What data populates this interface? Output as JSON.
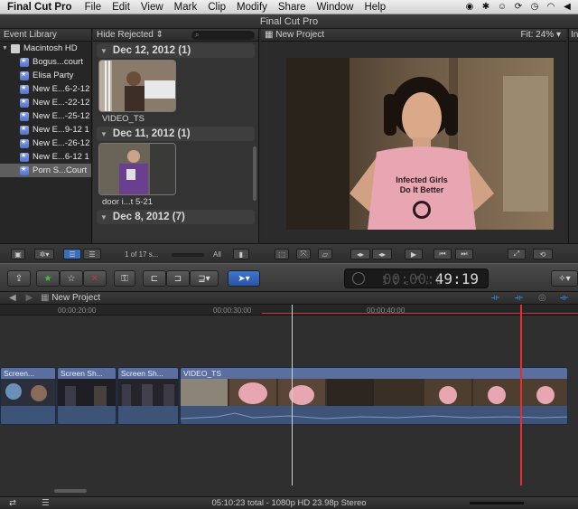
{
  "menubar": {
    "app_name": "Final Cut Pro",
    "items": [
      "File",
      "Edit",
      "View",
      "Mark",
      "Clip",
      "Modify",
      "Share",
      "Window",
      "Help"
    ]
  },
  "window": {
    "title": "Final Cut Pro"
  },
  "library": {
    "header": "Event Library",
    "root": "Macintosh HD",
    "events": [
      "Bogus...court",
      "Elisa Party",
      "New E...6-2-12",
      "New E...-22-12",
      "New E...-25-12",
      "New E...9-12 1",
      "New E...-26-12",
      "New E...6-12 1",
      "Porn S...Court"
    ],
    "selected_index": 8
  },
  "browser": {
    "filter_label": "Hide Rejected",
    "groups": [
      {
        "date": "Dec 12, 2012",
        "count": "(1)",
        "clip": "VIDEO_TS"
      },
      {
        "date": "Dec 11, 2012",
        "count": "(1)",
        "clip": "door i...t 5-21"
      },
      {
        "date": "Dec 8, 2012",
        "count": "(7)",
        "clip": ""
      }
    ],
    "selection_text": "1 of 17 s...",
    "zoom_label": "All"
  },
  "viewer": {
    "title": "New Project",
    "fit_label": "Fit:",
    "zoom": "24%",
    "shirt_text_line1": "Infected Girls",
    "shirt_text_line2": "Do It Better"
  },
  "inspector": {
    "title": "In"
  },
  "toolbar": {
    "timecode_value": "49:19",
    "timecode_dim": "00:00:",
    "timecode_units": "HR MIN SEC FR"
  },
  "timeline": {
    "title": "New Project",
    "ruler_ticks": [
      "00:00:20:00",
      "00:00:30:00",
      "00:00:40:00"
    ],
    "clips": [
      "Screen...",
      "Screen Sh...",
      "Screen Sh...",
      "VIDEO_TS"
    ]
  },
  "status": {
    "text": "05:10:23 total - 1080p HD 23.98p Stereo"
  }
}
